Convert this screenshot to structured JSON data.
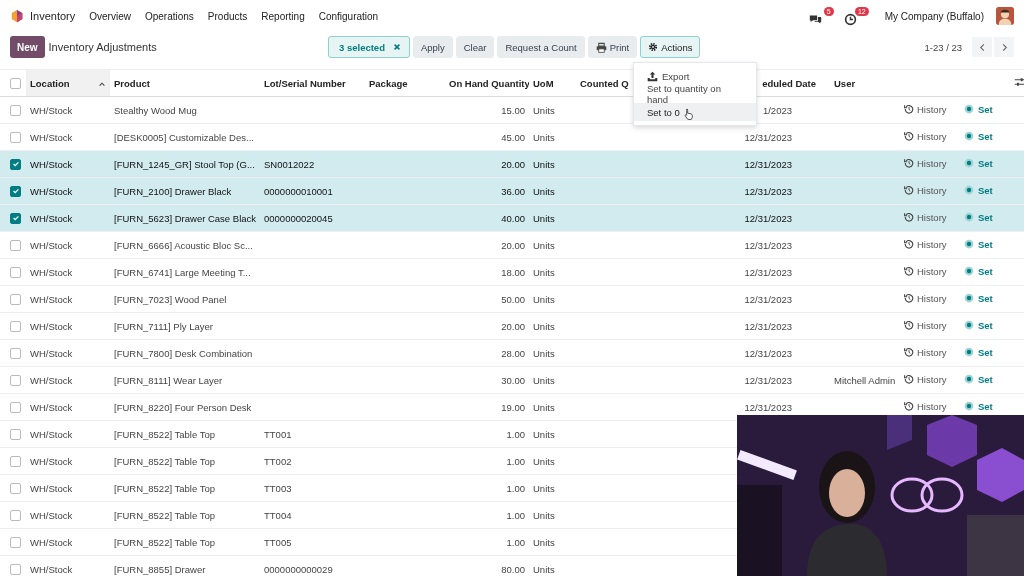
{
  "app": {
    "name": "Inventory",
    "menu": [
      "Overview",
      "Operations",
      "Products",
      "Reporting",
      "Configuration"
    ]
  },
  "systray": {
    "messages_badge": "5",
    "activities_badge": "12",
    "company": "My Company (Buffalo)"
  },
  "control_panel": {
    "new_button": "New",
    "title": "Inventory Adjustments",
    "selection": "3 selected",
    "buttons": [
      {
        "label": "Apply",
        "active": false
      },
      {
        "label": "Clear",
        "active": false
      },
      {
        "label": "Request a Count",
        "active": false
      },
      {
        "label": "Print",
        "active": false
      },
      {
        "label": "Actions",
        "active": true
      }
    ],
    "pager": "1-23 / 23"
  },
  "actions_menu": [
    {
      "label": "Export",
      "hovered": false
    },
    {
      "label": "Set to quantity on hand",
      "hovered": false
    },
    {
      "label": "Set to 0",
      "hovered": true
    }
  ],
  "table": {
    "all_selected": false,
    "columns": [
      {
        "label": "Location",
        "kind": "text",
        "sorted": true
      },
      {
        "label": "Product",
        "kind": "text",
        "sorted": false
      },
      {
        "label": "Lot/Serial Number",
        "kind": "text",
        "sorted": false
      },
      {
        "label": "Package",
        "kind": "text",
        "sorted": false
      },
      {
        "label": "On Hand Quantity",
        "kind": "number",
        "sorted": false
      },
      {
        "label": "UoM",
        "kind": "text",
        "sorted": false
      },
      {
        "label": "Counted Q",
        "kind": "text",
        "sorted": false
      },
      {
        "label": "eduled Date",
        "kind": "date",
        "sorted": false
      },
      {
        "label": "User",
        "kind": "text",
        "sorted": false
      }
    ],
    "rows": [
      {
        "selected": false,
        "location": "WH/Stock",
        "product": "Stealthy Wood Mug",
        "on_hand": "15.00",
        "uom": "Units",
        "date": "1/2023",
        "history": "History",
        "set": "Set"
      },
      {
        "selected": false,
        "location": "WH/Stock",
        "product": "[DESK0005] Customizable Des...",
        "on_hand": "45.00",
        "uom": "Units",
        "date": "12/31/2023",
        "history": "History",
        "set": "Set"
      },
      {
        "selected": true,
        "location": "WH/Stock",
        "product": "[FURN_1245_GR] Stool Top (G...",
        "lot": "SN0012022",
        "on_hand": "20.00",
        "uom": "Units",
        "date": "12/31/2023",
        "history": "History",
        "set": "Set"
      },
      {
        "selected": true,
        "location": "WH/Stock",
        "product": "[FURN_2100] Drawer Black",
        "lot": "0000000010001",
        "on_hand": "36.00",
        "uom": "Units",
        "date": "12/31/2023",
        "history": "History",
        "set": "Set"
      },
      {
        "selected": true,
        "location": "WH/Stock",
        "product": "[FURN_5623] Drawer Case Black",
        "lot": "0000000020045",
        "on_hand": "40.00",
        "uom": "Units",
        "date": "12/31/2023",
        "history": "History",
        "set": "Set"
      },
      {
        "selected": false,
        "location": "WH/Stock",
        "product": "[FURN_6666] Acoustic Bloc Sc...",
        "on_hand": "20.00",
        "uom": "Units",
        "date": "12/31/2023",
        "history": "History",
        "set": "Set"
      },
      {
        "selected": false,
        "location": "WH/Stock",
        "product": "[FURN_6741] Large Meeting T...",
        "on_hand": "18.00",
        "uom": "Units",
        "date": "12/31/2023",
        "history": "History",
        "set": "Set"
      },
      {
        "selected": false,
        "location": "WH/Stock",
        "product": "[FURN_7023] Wood Panel",
        "on_hand": "50.00",
        "uom": "Units",
        "date": "12/31/2023",
        "history": "History",
        "set": "Set"
      },
      {
        "selected": false,
        "location": "WH/Stock",
        "product": "[FURN_7111] Ply Layer",
        "on_hand": "20.00",
        "uom": "Units",
        "date": "12/31/2023",
        "history": "History",
        "set": "Set"
      },
      {
        "selected": false,
        "location": "WH/Stock",
        "product": "[FURN_7800] Desk Combination",
        "on_hand": "28.00",
        "uom": "Units",
        "date": "12/31/2023",
        "history": "History",
        "set": "Set"
      },
      {
        "selected": false,
        "location": "WH/Stock",
        "product": "[FURN_8111] Wear Layer",
        "on_hand": "30.00",
        "uom": "Units",
        "date": "12/31/2023",
        "user": "Mitchell Admin",
        "history": "History",
        "set": "Set"
      },
      {
        "selected": false,
        "location": "WH/Stock",
        "product": "[FURN_8220] Four Person Desk",
        "on_hand": "19.00",
        "uom": "Units",
        "date": "12/31/2023",
        "history": "History",
        "set": "Set"
      },
      {
        "selected": false,
        "location": "WH/Stock",
        "product": "[FURN_8522] Table Top",
        "lot": "TT001",
        "on_hand": "1.00",
        "uom": "Units"
      },
      {
        "selected": false,
        "location": "WH/Stock",
        "product": "[FURN_8522] Table Top",
        "lot": "TT002",
        "on_hand": "1.00",
        "uom": "Units"
      },
      {
        "selected": false,
        "location": "WH/Stock",
        "product": "[FURN_8522] Table Top",
        "lot": "TT003",
        "on_hand": "1.00",
        "uom": "Units"
      },
      {
        "selected": false,
        "location": "WH/Stock",
        "product": "[FURN_8522] Table Top",
        "lot": "TT004",
        "on_hand": "1.00",
        "uom": "Units"
      },
      {
        "selected": false,
        "location": "WH/Stock",
        "product": "[FURN_8522] Table Top",
        "lot": "TT005",
        "on_hand": "1.00",
        "uom": "Units"
      },
      {
        "selected": false,
        "location": "WH/Stock",
        "product": "[FURN_8855] Drawer",
        "lot": "0000000000029",
        "on_hand": "80.00",
        "uom": "Units"
      }
    ]
  }
}
